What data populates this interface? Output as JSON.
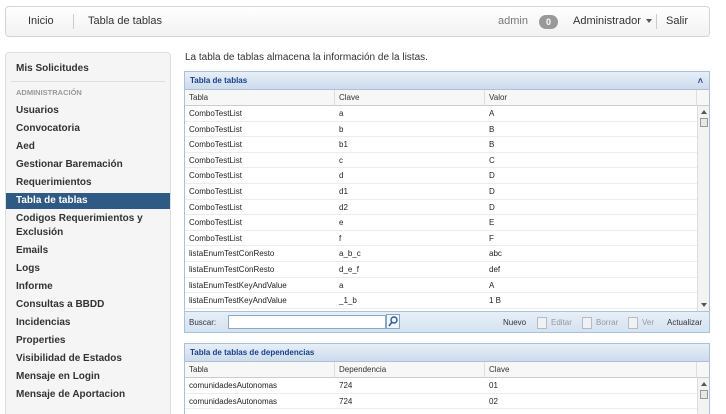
{
  "nav": {
    "inicio": "Inicio",
    "title": "Tabla de tablas",
    "user": "admin",
    "badge": "0",
    "role": "Administrador",
    "salir": "Salir"
  },
  "sidebar": {
    "top_item": "Mis Solicitudes",
    "section": "ADMINISTRACIÓN",
    "items": [
      "Usuarios",
      "Convocatoria",
      "Aed",
      "Gestionar Baremación",
      "Requerimientos",
      "Tabla de tablas",
      "Codigos Requerimientos y Exclusión",
      "Emails",
      "Logs",
      "Informe",
      "Consultas a BBDD",
      "Incidencias",
      "Properties",
      "Visibilidad de Estados",
      "Mensaje en Login",
      "Mensaje de Aportacion"
    ],
    "active_index": 5
  },
  "intro": "La tabla de tablas almacena la información de la listas.",
  "panel1": {
    "title": "Tabla de tablas",
    "toggle": "˄",
    "columns": [
      "Tabla",
      "Clave",
      "Valor"
    ],
    "rows": [
      [
        "ComboTestList",
        "a",
        "A"
      ],
      [
        "ComboTestList",
        "b",
        "B"
      ],
      [
        "ComboTestList",
        "b1",
        "B"
      ],
      [
        "ComboTestList",
        "c",
        "C"
      ],
      [
        "ComboTestList",
        "d",
        "D"
      ],
      [
        "ComboTestList",
        "d1",
        "D"
      ],
      [
        "ComboTestList",
        "d2",
        "D"
      ],
      [
        "ComboTestList",
        "e",
        "E"
      ],
      [
        "ComboTestList",
        "f",
        "F"
      ],
      [
        "listaEnumTestConResto",
        "a_b_c",
        "abc"
      ],
      [
        "listaEnumTestConResto",
        "d_e_f",
        "def"
      ],
      [
        "listaEnumTestKeyAndValue",
        "a",
        "A"
      ],
      [
        "listaEnumTestKeyAndValue",
        "_1_b",
        "1 B"
      ]
    ],
    "toolbar": {
      "buscar": "Buscar:",
      "search_value": "",
      "nuevo": "Nuevo",
      "editar": "Editar",
      "borrar": "Borrar",
      "ver": "Ver",
      "actualizar": "Actualizar"
    }
  },
  "panel2": {
    "title": "Tabla de tablas de dependencias",
    "columns": [
      "Tabla",
      "Dependencia",
      "Clave"
    ],
    "rows": [
      [
        "comunidadesAutonomas",
        "724",
        "01"
      ],
      [
        "comunidadesAutonomas",
        "724",
        "02"
      ]
    ]
  }
}
